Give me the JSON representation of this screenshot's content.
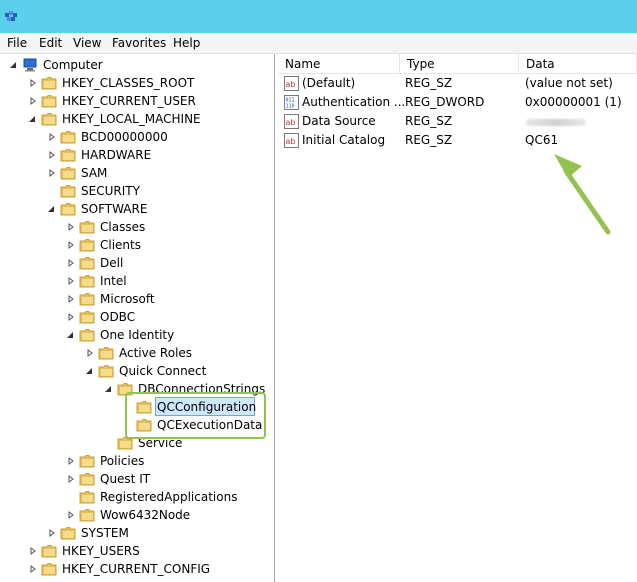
{
  "menu": [
    "File",
    "Edit",
    "View",
    "Favorites",
    "Help"
  ],
  "tree": {
    "root_label": "Computer",
    "nodes": [
      "HKEY_CLASSES_ROOT",
      "HKEY_CURRENT_USER",
      "HKEY_LOCAL_MACHINE",
      "BCD00000000",
      "HARDWARE",
      "SAM",
      "SECURITY",
      "SOFTWARE",
      "Classes",
      "Clients",
      "Dell",
      "Intel",
      "Microsoft",
      "ODBC",
      "One Identity",
      "Active Roles",
      "Quick Connect",
      "DBConnectionStrings",
      "QCConfiguration",
      "QCExecutionData",
      "Service",
      "Policies",
      "Quest IT",
      "RegisteredApplications",
      "Wow6432Node",
      "SYSTEM",
      "HKEY_USERS",
      "HKEY_CURRENT_CONFIG"
    ],
    "selected": "QCConfiguration"
  },
  "list": {
    "columns": [
      "Name",
      "Type",
      "Data"
    ],
    "rows": [
      {
        "name": "(Default)",
        "type": "REG_SZ",
        "data": "(value not set)",
        "icon": "string-value-icon"
      },
      {
        "name": "Authentication ...",
        "type": "REG_DWORD",
        "data": "0x00000001 (1)",
        "icon": "dword-value-icon"
      },
      {
        "name": "Data Source",
        "type": "REG_SZ",
        "data": "",
        "icon": "string-value-icon"
      },
      {
        "name": "Initial Catalog",
        "type": "REG_SZ",
        "data": "QC61",
        "icon": "string-value-icon"
      }
    ]
  },
  "colors": {
    "titlebar": "#5ccfec",
    "annotation": "#93c251",
    "selection": "#cde8ff",
    "folder": "#e8c15a"
  }
}
